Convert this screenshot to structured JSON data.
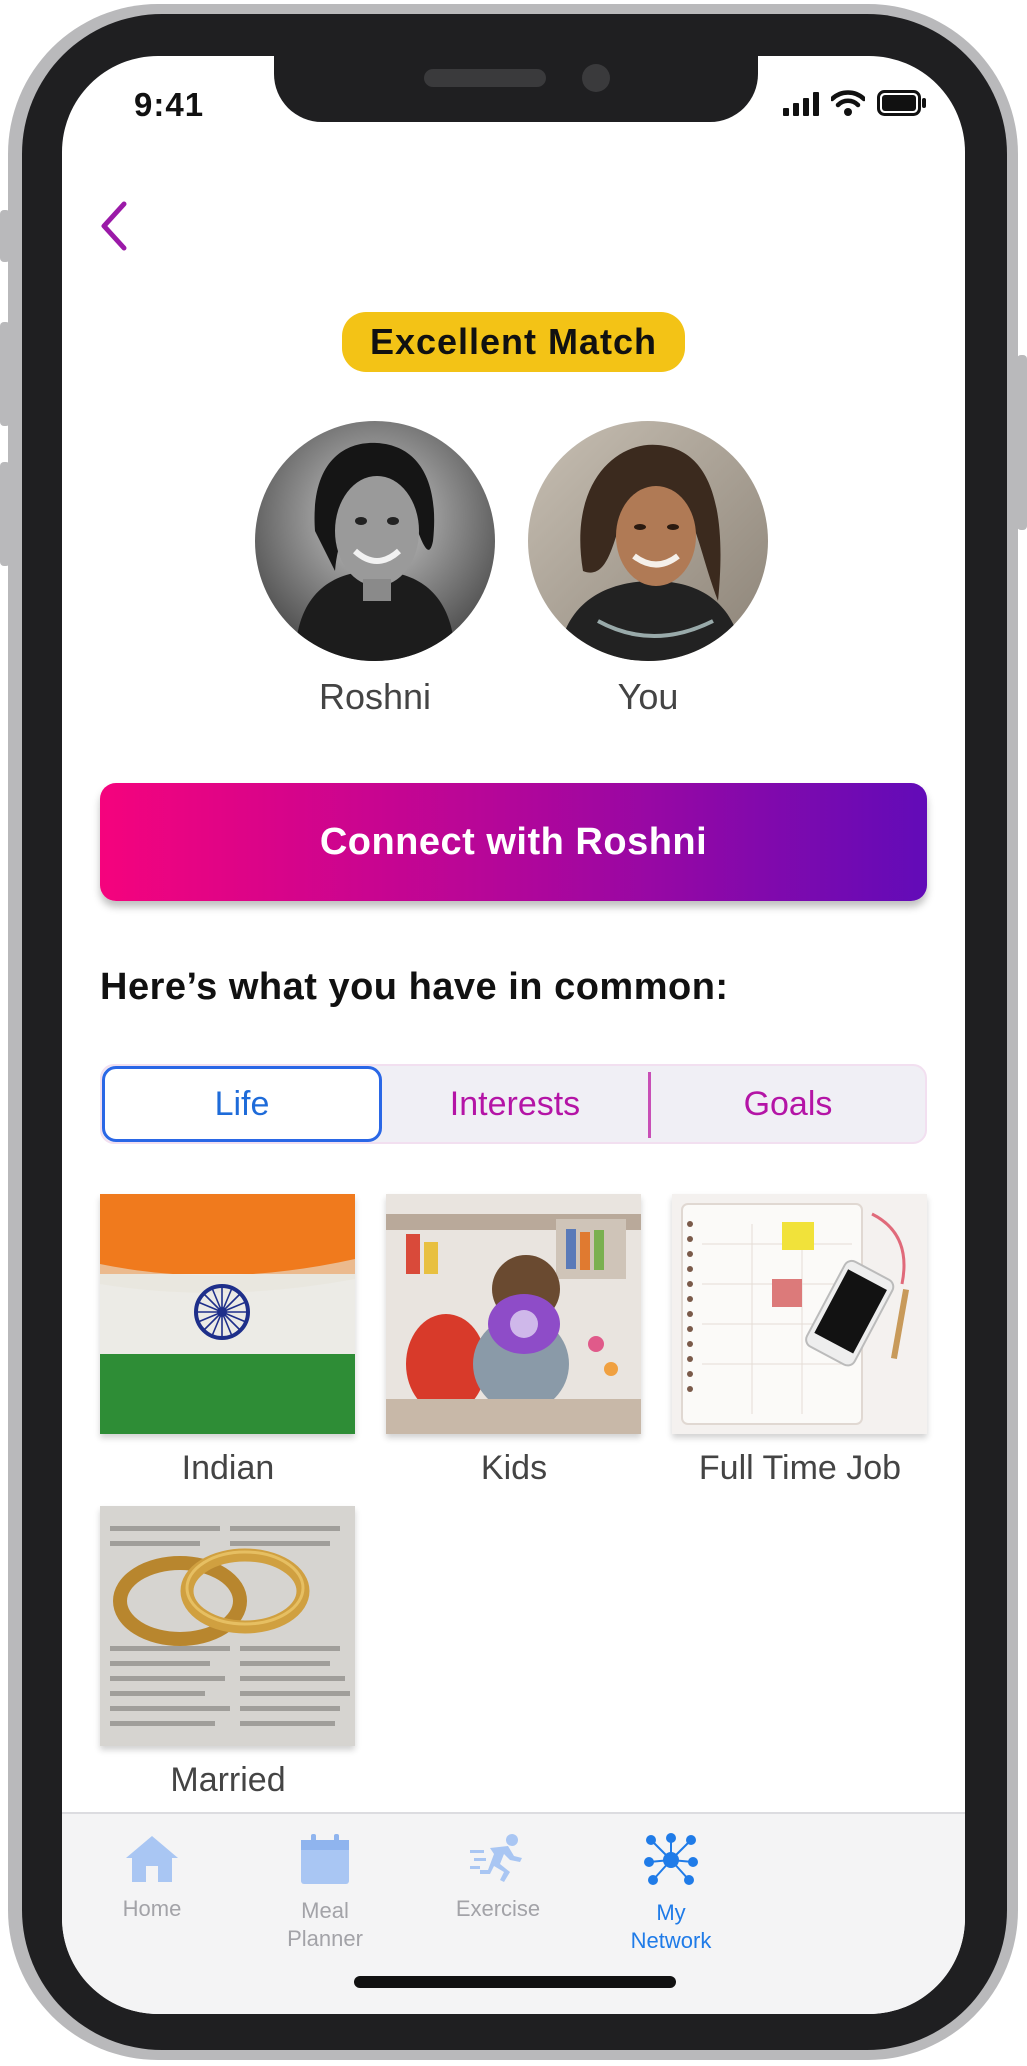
{
  "status_bar": {
    "time": "9:41"
  },
  "match": {
    "badge": "Excellent Match",
    "people": [
      {
        "name": "Roshni"
      },
      {
        "name": "You"
      }
    ]
  },
  "connect_button": {
    "label": "Connect with Roshni"
  },
  "common": {
    "title": "Here’s what you have in common:",
    "tabs": [
      {
        "label": "Life",
        "active": true
      },
      {
        "label": "Interests",
        "active": false
      },
      {
        "label": "Goals",
        "active": false
      }
    ],
    "items": [
      {
        "label": "Indian"
      },
      {
        "label": "Kids"
      },
      {
        "label": "Full Time Job"
      },
      {
        "label": "Married"
      }
    ]
  },
  "tab_bar": {
    "items": [
      {
        "label": "Home",
        "icon": "home-icon",
        "active": false
      },
      {
        "label": "Meal\nPlanner",
        "icon": "calendar-icon",
        "active": false
      },
      {
        "label": "Exercise",
        "icon": "runner-icon",
        "active": false
      },
      {
        "label": "My\nNetwork",
        "icon": "network-icon",
        "active": true
      }
    ]
  },
  "colors": {
    "accent_purple": "#9b1aa8",
    "badge_yellow": "#f3c316",
    "gradient_start": "#f5037d",
    "gradient_end": "#620bb8",
    "active_blue": "#1f7be8",
    "inactive_gray": "#a3a3a8"
  }
}
